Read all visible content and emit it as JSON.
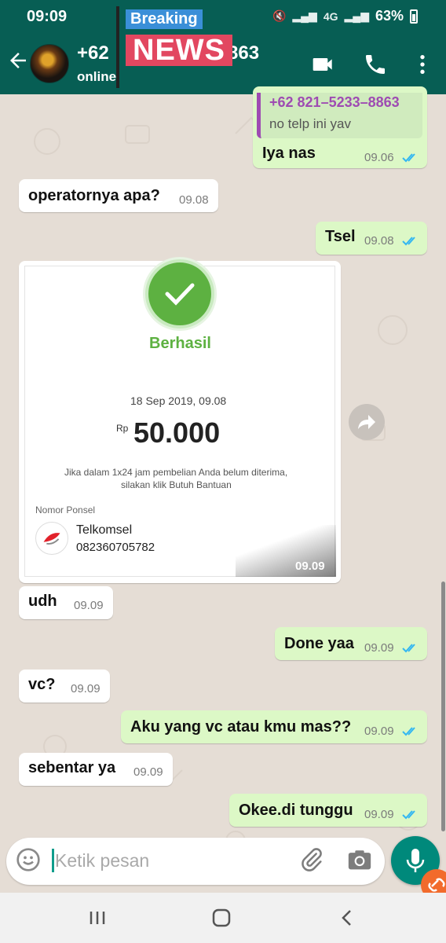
{
  "status_bar": {
    "time": "09:09",
    "signal": "4G",
    "battery": "63%"
  },
  "app_bar": {
    "contact_prefix": "+62",
    "contact_suffix": "863",
    "status": "online"
  },
  "overlay": {
    "line1": "Breaking",
    "line2": "NEWS"
  },
  "messages": [
    {
      "dir": "out",
      "quote_name": "+62 821–5233–8863",
      "quote_text": "no telp ini yav",
      "text": "Iya nas",
      "time": "09.06"
    },
    {
      "dir": "in",
      "text": "operatornya apa?",
      "time": "09.08"
    },
    {
      "dir": "out",
      "text": "Tsel",
      "time": "09.08"
    },
    {
      "dir": "in",
      "type": "image",
      "time": "09.09"
    },
    {
      "dir": "in",
      "text": "udh",
      "time": "09.09"
    },
    {
      "dir": "out",
      "text": "Done yaa",
      "time": "09.09"
    },
    {
      "dir": "in",
      "text": "vc?",
      "time": "09.09"
    },
    {
      "dir": "out",
      "text": "Aku yang vc atau kmu mas??",
      "time": "09.09"
    },
    {
      "dir": "in",
      "text": "sebentar ya",
      "time": "09.09"
    },
    {
      "dir": "out",
      "text": "Okee.di tunggu",
      "time": "09.09"
    }
  ],
  "receipt": {
    "status": "Berhasil",
    "date": "18 Sep 2019, 09.08",
    "currency": "Rp",
    "amount": "50.000",
    "note_line1": "Jika dalam 1x24 jam pembelian Anda belum diterima,",
    "note_line2": "silakan klik Butuh Bantuan",
    "label": "Nomor Ponsel",
    "operator": "Telkomsel",
    "phone": "082360705782"
  },
  "composer": {
    "placeholder": "Ketik pesan"
  },
  "colors": {
    "header": "#075e54",
    "outgoing": "#dcf8c6",
    "incoming": "#ffffff",
    "tick": "#34b7f1",
    "accent": "#00897b"
  },
  "icons": [
    "back-arrow-icon",
    "video-call-icon",
    "phone-icon",
    "more-vert-icon",
    "forward-icon",
    "emoji-icon",
    "attach-icon",
    "camera-icon",
    "mic-icon",
    "recents-icon",
    "home-icon",
    "back-icon"
  ]
}
